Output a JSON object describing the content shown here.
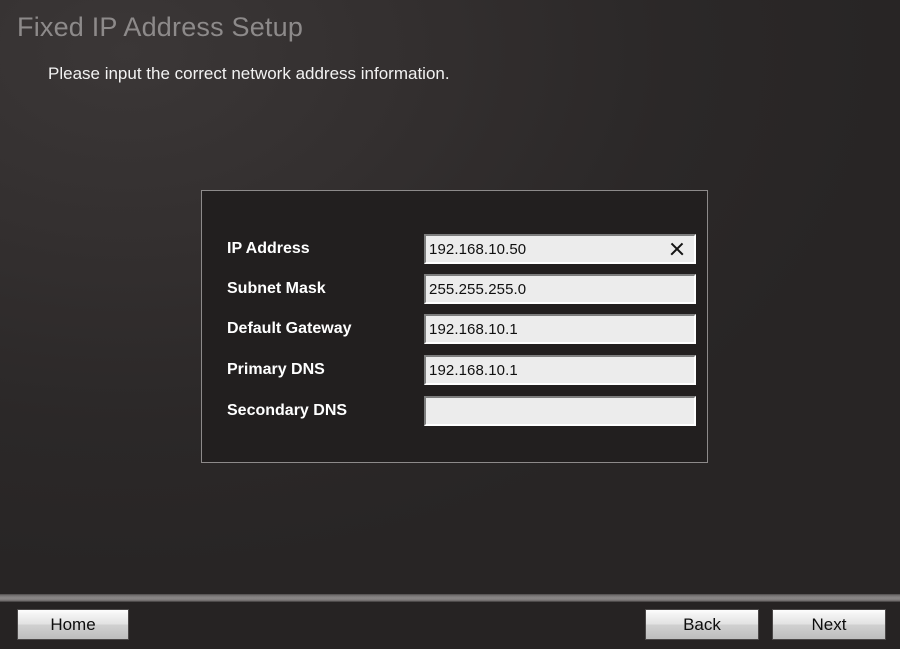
{
  "header": {
    "title": "Fixed IP Address Setup",
    "subtitle": "Please input the correct network address information."
  },
  "form": {
    "fields": [
      {
        "label": "IP Address",
        "value": "192.168.10.50",
        "placeholder": "",
        "clear_icon": "close-x-icon"
      },
      {
        "label": "Subnet Mask",
        "value": "255.255.255.0",
        "placeholder": ""
      },
      {
        "label": "Default Gateway",
        "value": "192.168.10.1",
        "placeholder": ""
      },
      {
        "label": "Primary DNS",
        "value": "192.168.10.1",
        "placeholder": ""
      },
      {
        "label": "Secondary DNS",
        "value": "",
        "placeholder": ""
      }
    ]
  },
  "footer": {
    "home_label": "Home",
    "back_label": "Back",
    "next_label": "Next"
  },
  "colors": {
    "background": "#2a2727",
    "panel_background": "#221f1f",
    "panel_border": "#8d8a8a",
    "title_text": "#8d8a8a",
    "subtitle_text": "#f2f2f2",
    "label_text": "#ffffff",
    "input_background": "#ececec",
    "input_text": "#101010",
    "button_text": "#0d0d0d",
    "divider": "#8b8888"
  }
}
